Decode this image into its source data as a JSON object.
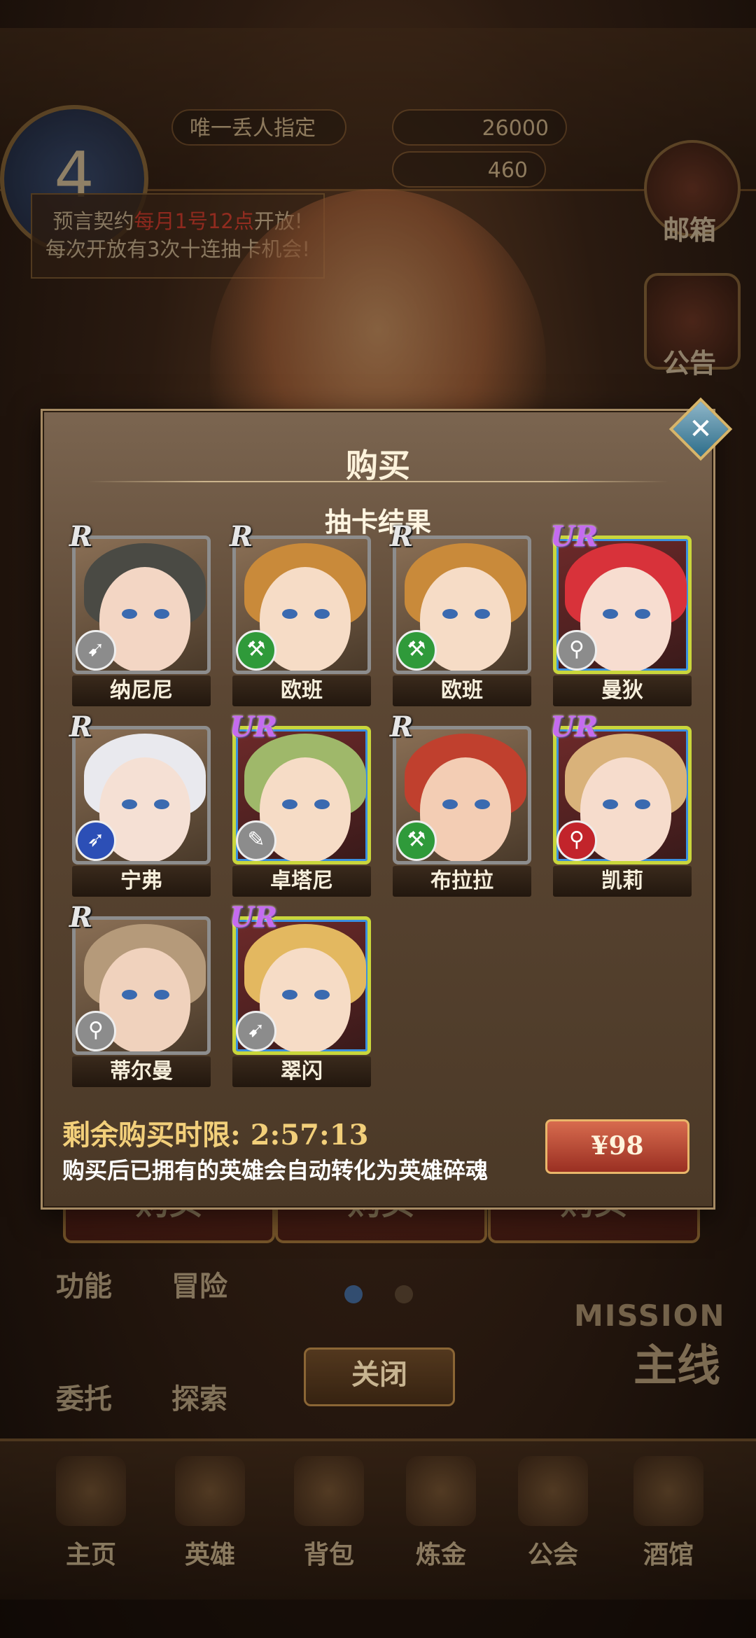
{
  "background": {
    "top_label": "唯一丢人指定",
    "gold": "26000",
    "gems": "460",
    "round_number": "4",
    "notice": {
      "line1_prefix": "预言契约",
      "line1_highlight": "每月1号12点",
      "line1_suffix": "开放!",
      "line2": "每次开放有3次十连抽卡机会!"
    },
    "side_buttons": [
      "邮箱",
      "公告"
    ],
    "buy_buttons": [
      "购买",
      "购买",
      "购买"
    ],
    "tabs": [
      "功能",
      "冒险",
      "委托",
      "探索"
    ],
    "close_label": "关闭",
    "mission_en": "MISSION",
    "mission_cn": "主线",
    "nav": [
      "主页",
      "英雄",
      "背包",
      "炼金",
      "公会",
      "酒馆"
    ]
  },
  "dialog": {
    "title": "购买",
    "subtitle": "抽卡结果",
    "close_icon": "✕",
    "cards": [
      {
        "name": "纳尼尼",
        "rarity": "R",
        "weapon": "bow",
        "weapon_color": "gray",
        "hair": "#4a4a44",
        "skin": "#f3d6c4"
      },
      {
        "name": "欧班",
        "rarity": "R",
        "weapon": "axe",
        "weapon_color": "green",
        "hair": "#c98a3a",
        "skin": "#f6dcc6"
      },
      {
        "name": "欧班",
        "rarity": "R",
        "weapon": "axe",
        "weapon_color": "green",
        "hair": "#c98a3a",
        "skin": "#f6dcc6"
      },
      {
        "name": "曼狄",
        "rarity": "UR",
        "weapon": "staff",
        "weapon_color": "gray",
        "hair": "#d8323a",
        "skin": "#f7ddd0"
      },
      {
        "name": "宁弗",
        "rarity": "R",
        "weapon": "spear",
        "weapon_color": "blue",
        "hair": "#e9e9ee",
        "skin": "#f5e0d4"
      },
      {
        "name": "卓塔尼",
        "rarity": "UR",
        "weapon": "gun",
        "weapon_color": "gray",
        "hair": "#9fb86a",
        "skin": "#f6dcc6"
      },
      {
        "name": "布拉拉",
        "rarity": "R",
        "weapon": "axe",
        "weapon_color": "green",
        "hair": "#c0402e",
        "skin": "#f3cdb4"
      },
      {
        "name": "凯莉",
        "rarity": "UR",
        "weapon": "staff",
        "weapon_color": "red",
        "hair": "#d9b27a",
        "skin": "#f6dccc"
      },
      {
        "name": "蒂尔曼",
        "rarity": "R",
        "weapon": "staff",
        "weapon_color": "gray",
        "hair": "#b59a7a",
        "skin": "#f0d2bd"
      },
      {
        "name": "翠闪",
        "rarity": "UR",
        "weapon": "bow",
        "weapon_color": "gray",
        "hair": "#e3b860",
        "skin": "#f6dcc6"
      }
    ],
    "timer_label": "剩余购买时限:",
    "timer_value": "2:57:13",
    "note": "购买后已拥有的英雄会自动转化为英雄碎魂",
    "price": "¥98"
  },
  "colors": {
    "accent": "#f2cf7a",
    "ur_border": "#c9d63c",
    "price_btn": "#b8432f"
  }
}
